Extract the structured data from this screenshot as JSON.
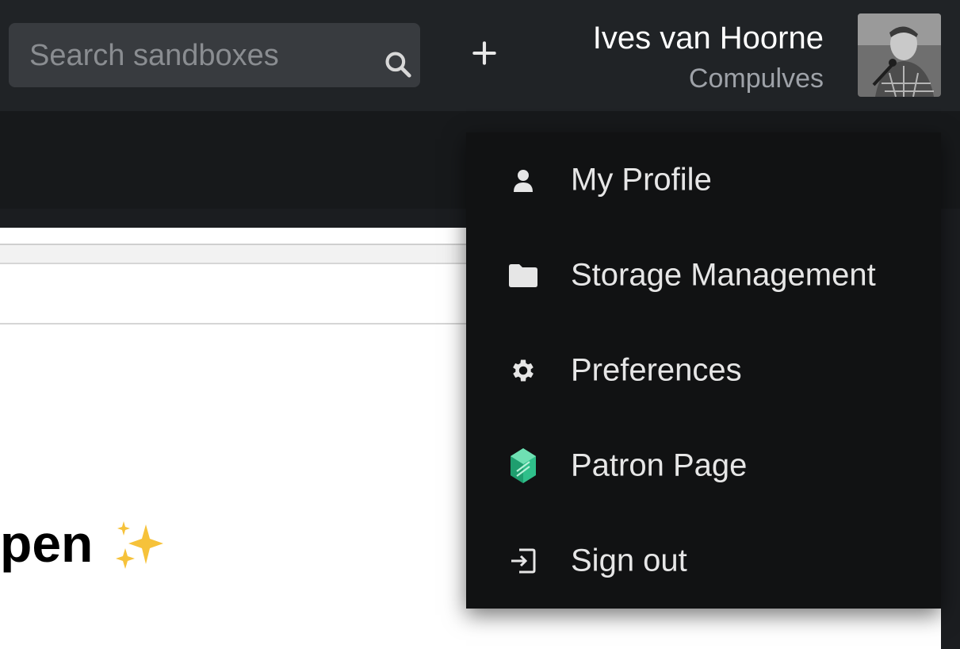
{
  "search": {
    "placeholder": "Search sandboxes"
  },
  "user": {
    "name": "Ives van Hoorne",
    "username": "Compulves"
  },
  "menu": {
    "items": [
      {
        "label": "My Profile",
        "icon": "user-icon"
      },
      {
        "label": "Storage Management",
        "icon": "folder-icon"
      },
      {
        "label": "Preferences",
        "icon": "gear-icon"
      },
      {
        "label": "Patron Page",
        "icon": "patron-gem-icon"
      },
      {
        "label": "Sign out",
        "icon": "sign-out-icon"
      }
    ]
  },
  "content": {
    "heading_fragment": "pen"
  },
  "colors": {
    "header_bg": "#202326",
    "menu_bg": "#111213",
    "search_bg": "#383b3f",
    "patron_green": "#2fbf8a"
  }
}
